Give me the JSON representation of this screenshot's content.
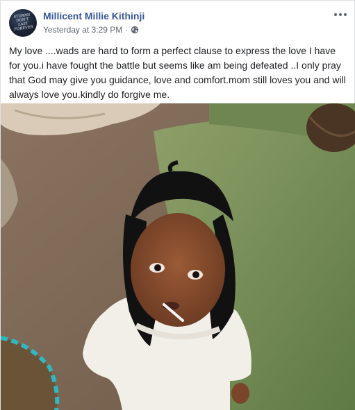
{
  "post": {
    "author": "Millicent Millie Kithinji",
    "timestamp": "Yesterday at 3:29 PM",
    "separator": "·",
    "audience_icon": "globe-icon",
    "more_icon": "more-options-icon",
    "avatar_text": "STORMS DON'T LAST FOREVER",
    "message": "My love ....wads are hard to form a perfect clause to express the love I have for you.i have fought the battle but seems like am being defeated ..I only pray that God may give you guidance, love and comfort.mom still loves you and will always love you.kindly do forgive me."
  },
  "colors": {
    "author_link": "#385898",
    "meta_text": "#606770",
    "body_text": "#1c1e21",
    "border": "#dddfe2"
  }
}
